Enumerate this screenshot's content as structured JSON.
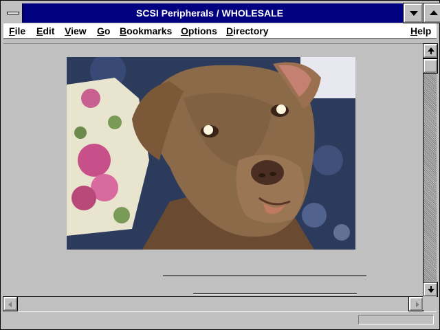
{
  "window": {
    "title": "SCSI Peripherals / WHOLESALE"
  },
  "menubar": {
    "items": [
      {
        "label": "File",
        "mnemonic": "F",
        "rest": "ile"
      },
      {
        "label": "Edit",
        "mnemonic": "E",
        "rest": "dit"
      },
      {
        "label": "View",
        "mnemonic": "V",
        "rest": "iew"
      },
      {
        "label": "Go",
        "mnemonic": "G",
        "rest": "o"
      },
      {
        "label": "Bookmarks",
        "mnemonic": "B",
        "rest": "ookmarks"
      },
      {
        "label": "Options",
        "mnemonic": "O",
        "rest": "ptions"
      },
      {
        "label": "Directory",
        "mnemonic": "D",
        "rest": "irectory"
      },
      {
        "label": "Help",
        "mnemonic": "H",
        "rest": "elp"
      }
    ]
  },
  "content": {
    "image_subject": "dog-photo"
  },
  "statusbar": {
    "text": "",
    "progress": 0
  },
  "colors": {
    "titlebar": "#000080",
    "face": "#c0c0c0",
    "menubar": "#ffffff"
  },
  "icons": {
    "system_menu": "system-menu-icon",
    "minimize": "minimize-icon",
    "maximize": "maximize-icon",
    "scroll_up": "scroll-up-arrow-icon",
    "scroll_down": "scroll-down-arrow-icon",
    "scroll_left": "scroll-left-arrow-icon",
    "scroll_right": "scroll-right-arrow-icon"
  }
}
